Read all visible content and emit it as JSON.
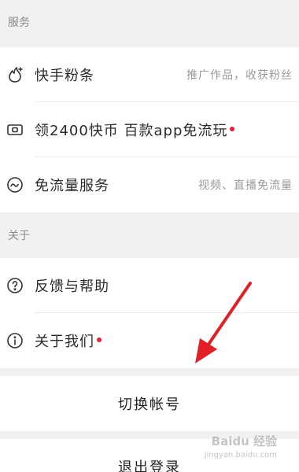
{
  "sections": {
    "service_title": "服务",
    "about_title": "关于"
  },
  "service_items": [
    {
      "label": "快手粉条",
      "hint": "推广作品，收获粉丝",
      "icon": "fire-icon"
    },
    {
      "label": "领2400快币 百款app免流玩",
      "hint": "",
      "icon": "wallet-icon",
      "badge": true
    },
    {
      "label": "免流量服务",
      "hint": "视频、直播免流量",
      "icon": "wave-icon"
    }
  ],
  "about_items": [
    {
      "label": "反馈与帮助",
      "icon": "question-icon"
    },
    {
      "label": "关于我们",
      "icon": "info-icon",
      "badge": true
    }
  ],
  "actions": {
    "switch_account": "切换帐号",
    "logout": "退出登录"
  },
  "watermark": {
    "text": "Baidu 经验",
    "sub": "jingyan.baidu.com"
  },
  "colors": {
    "badge": "#e8213a",
    "arrow": "#e21f26",
    "background": "#f1f1f1"
  }
}
